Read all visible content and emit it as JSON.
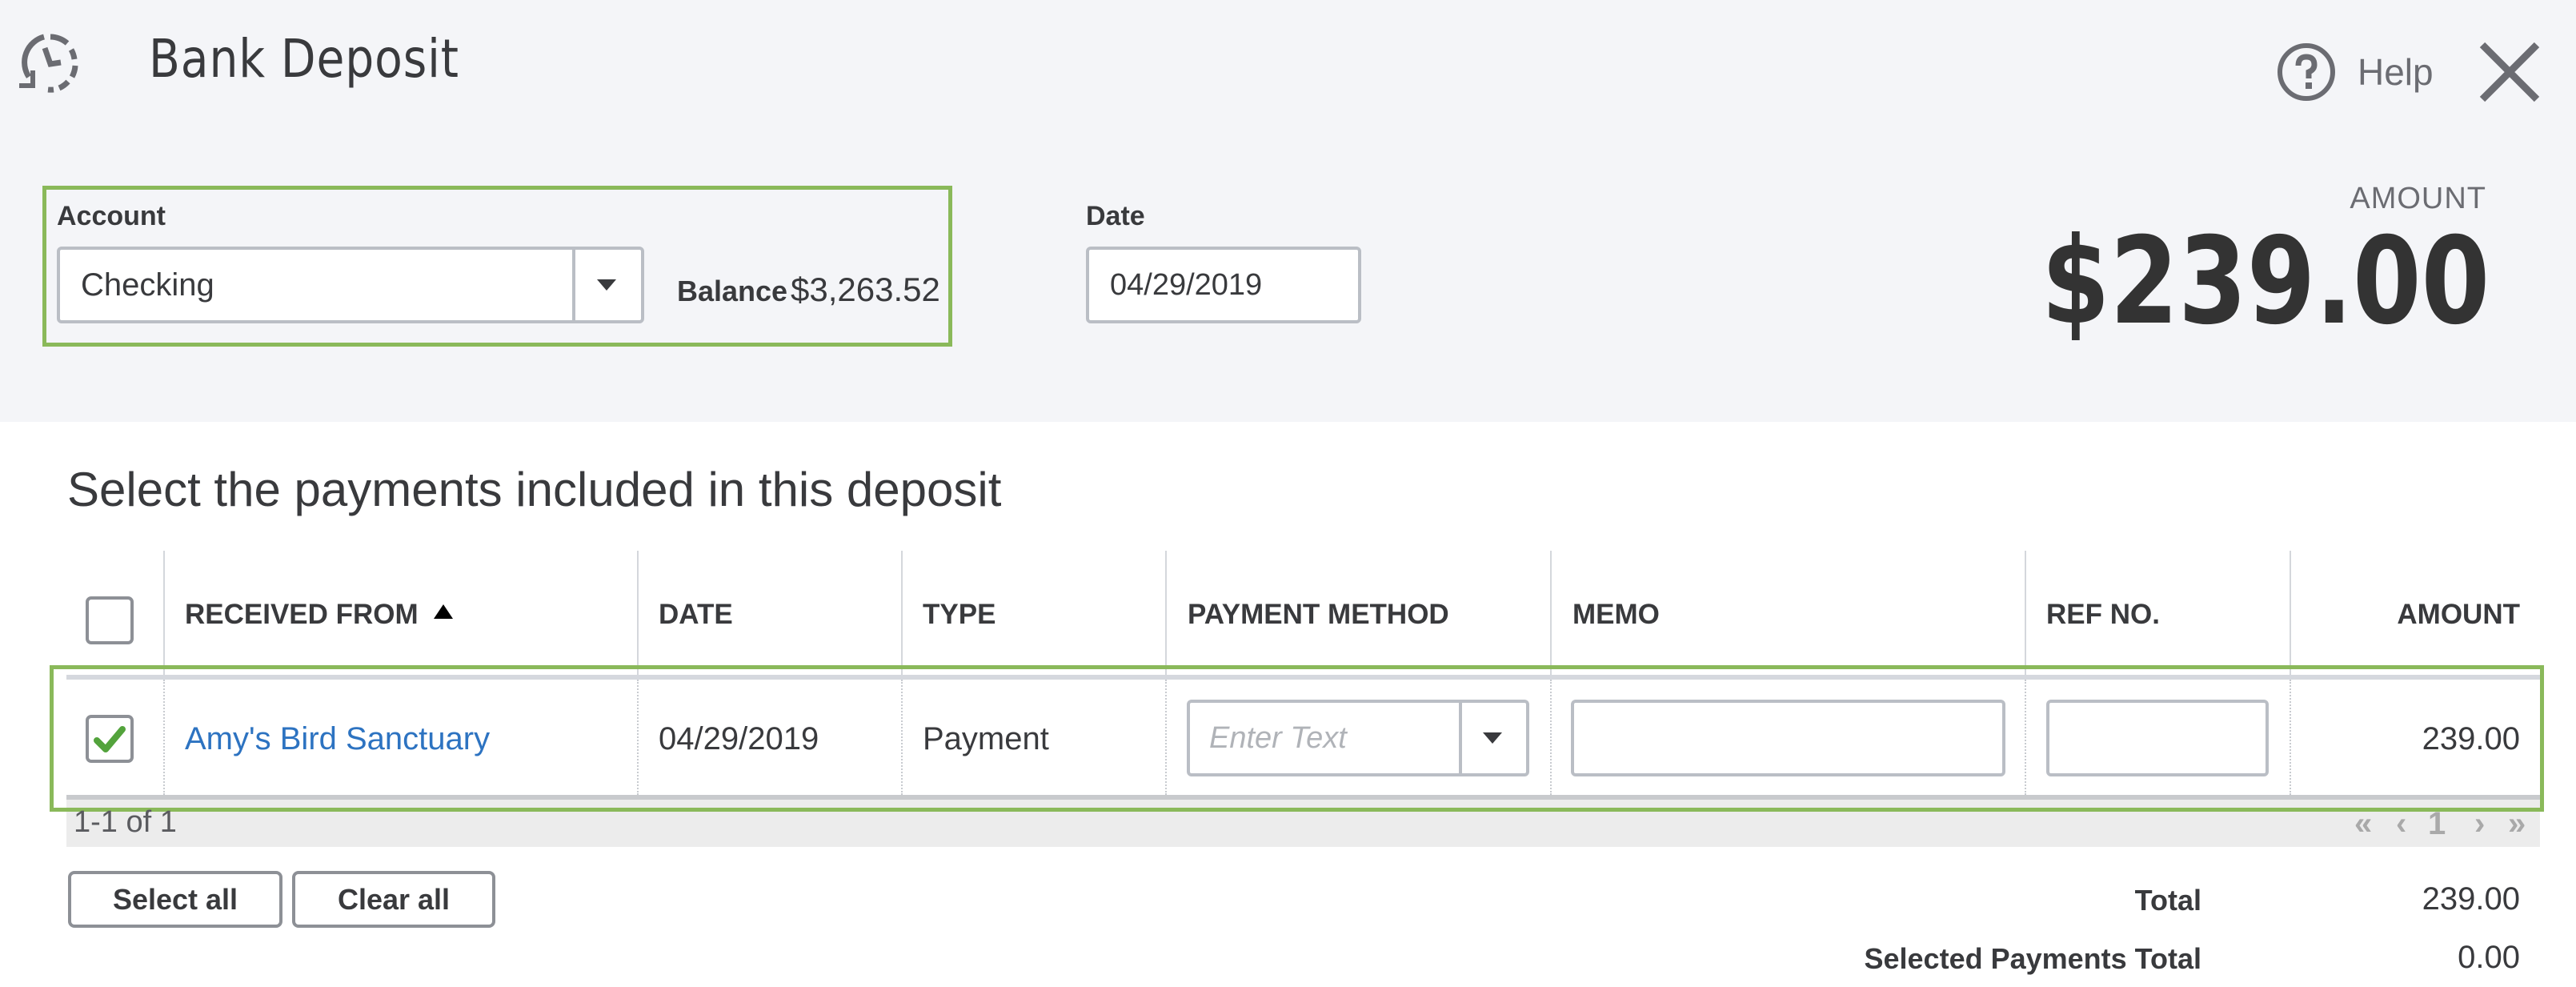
{
  "header": {
    "title": "Bank Deposit",
    "history_icon": "history-clock-icon",
    "help_label": "Help",
    "help_icon": "question-circle-icon",
    "close_icon": "close-x-icon"
  },
  "form": {
    "account_label": "Account",
    "account_value": "Checking",
    "balance_label": "Balance",
    "balance_value": "$3,263.52",
    "date_label": "Date",
    "date_value": "04/29/2019",
    "amount_label": "AMOUNT",
    "amount_value": "$239.00"
  },
  "payments": {
    "heading": "Select the payments included in this deposit",
    "columns": {
      "received_from": "RECEIVED FROM",
      "date": "DATE",
      "type": "TYPE",
      "payment_method": "PAYMENT METHOD",
      "memo": "MEMO",
      "ref_no": "REF NO.",
      "amount": "AMOUNT"
    },
    "sort": {
      "column": "received_from",
      "direction": "ascending"
    },
    "select_all_checked": false,
    "rows": [
      {
        "checked": true,
        "received_from": "Amy's Bird Sanctuary",
        "date": "04/29/2019",
        "type": "Payment",
        "payment_method": "",
        "payment_method_placeholder": "Enter Text",
        "memo": "",
        "ref_no": "",
        "amount": "239.00"
      }
    ],
    "pagination": {
      "summary": "1-1 of 1",
      "first": "«",
      "prev": "‹",
      "current_page": "1",
      "next": "›",
      "last": "»"
    },
    "select_all_label": "Select all",
    "clear_all_label": "Clear all",
    "total_label": "Total",
    "total_value": "239.00",
    "selected_total_label": "Selected Payments Total",
    "selected_total_value": "0.00"
  },
  "colors": {
    "highlight": "#8ab95a",
    "link": "#2d73c1",
    "check": "#53a33c",
    "header_bg": "#f4f5f8"
  }
}
